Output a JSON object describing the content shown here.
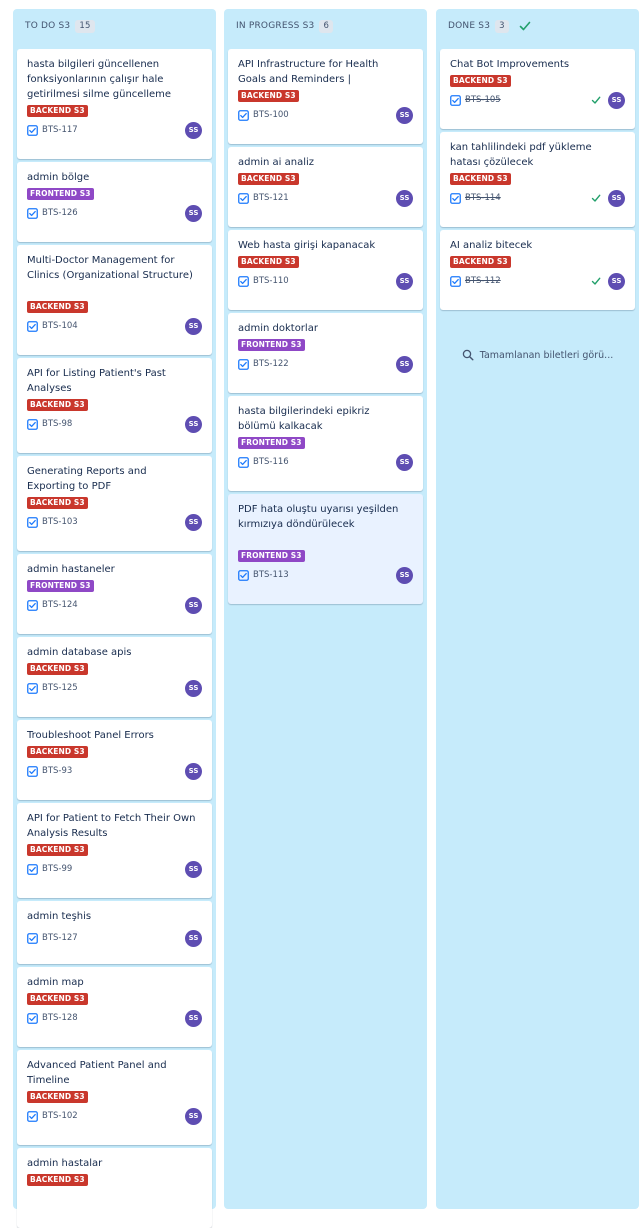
{
  "columns": [
    {
      "title": "TO DO S3",
      "count": "15",
      "cards": [
        {
          "title": "hasta bilgileri güncellenen fonksiyonlarının çalışır hale getirilmesi silme güncelleme",
          "label": "BACKEND S3",
          "label_kind": "backend",
          "key": "BTS-117",
          "assignee": "SS"
        },
        {
          "title": "admin bölge",
          "label": "FRONTEND S3",
          "label_kind": "frontend",
          "key": "BTS-126",
          "assignee": "SS"
        },
        {
          "title": "Multi-Doctor Management for Clinics (Organizational Structure)",
          "label": "BACKEND S3",
          "label_kind": "backend",
          "key": "BTS-104",
          "assignee": "SS"
        },
        {
          "title": "API for Listing Patient's Past Analyses",
          "label": "BACKEND S3",
          "label_kind": "backend",
          "key": "BTS-98",
          "assignee": "SS"
        },
        {
          "title": "Generating Reports and Exporting to PDF",
          "label": "BACKEND S3",
          "label_kind": "backend",
          "key": "BTS-103",
          "assignee": "SS"
        },
        {
          "title": "admin hastaneler",
          "label": "FRONTEND S3",
          "label_kind": "frontend",
          "key": "BTS-124",
          "assignee": "SS"
        },
        {
          "title": "admin database apis",
          "label": "BACKEND S3",
          "label_kind": "backend",
          "key": "BTS-125",
          "assignee": "SS"
        },
        {
          "title": "Troubleshoot Panel Errors",
          "label": "BACKEND S3",
          "label_kind": "backend",
          "key": "BTS-93",
          "assignee": "SS"
        },
        {
          "title": "API for Patient to Fetch Their Own Analysis Results",
          "label": "BACKEND S3",
          "label_kind": "backend",
          "key": "BTS-99",
          "assignee": "SS"
        },
        {
          "title": "admin teşhis",
          "label": "",
          "label_kind": "",
          "key": "BTS-127",
          "assignee": "SS"
        },
        {
          "title": "admin map",
          "label": "BACKEND S3",
          "label_kind": "backend",
          "key": "BTS-128",
          "assignee": "SS"
        },
        {
          "title": "Advanced Patient Panel and Timeline",
          "label": "BACKEND S3",
          "label_kind": "backend",
          "key": "BTS-102",
          "assignee": "SS"
        },
        {
          "title": "admin hastalar",
          "label": "BACKEND S3",
          "label_kind": "backend",
          "key": "",
          "assignee": ""
        }
      ]
    },
    {
      "title": "IN PROGRESS S3",
      "count": "6",
      "cards": [
        {
          "title": "API Infrastructure for Health Goals and Reminders |",
          "label": "BACKEND S3",
          "label_kind": "backend",
          "key": "BTS-100",
          "assignee": "SS"
        },
        {
          "title": "admin ai analiz",
          "label": "BACKEND S3",
          "label_kind": "backend",
          "key": "BTS-121",
          "assignee": "SS"
        },
        {
          "title": "Web hasta girişi kapanacak",
          "label": "BACKEND S3",
          "label_kind": "backend",
          "key": "BTS-110",
          "assignee": "SS"
        },
        {
          "title": "admin doktorlar",
          "label": "FRONTEND S3",
          "label_kind": "frontend",
          "key": "BTS-122",
          "assignee": "SS"
        },
        {
          "title": "hasta bilgilerindeki epikriz bölümü kalkacak",
          "label": "FRONTEND S3",
          "label_kind": "frontend",
          "key": "BTS-116",
          "assignee": "SS"
        },
        {
          "title": "PDF hata oluştu uyarısı yeşilden kırmızıya döndürülecek",
          "label": "FRONTEND S3",
          "label_kind": "frontend",
          "key": "BTS-113",
          "assignee": "SS"
        }
      ]
    },
    {
      "title": "DONE S3",
      "count": "3",
      "cards": [
        {
          "title": "Chat Bot Improvements",
          "label": "BACKEND S3",
          "label_kind": "backend",
          "key": "BTS-105",
          "assignee": "SS"
        },
        {
          "title": "kan tahlilindeki pdf yükleme hatası çözülecek",
          "label": "BACKEND S3",
          "label_kind": "backend",
          "key": "BTS-114",
          "assignee": "SS"
        },
        {
          "title": "AI analiz bitecek",
          "label": "BACKEND S3",
          "label_kind": "backend",
          "key": "BTS-112",
          "assignee": "SS"
        }
      ],
      "search_completed": "Tamamlanan biletleri görü..."
    }
  ],
  "colors": {
    "column_bg": "#c6ebfb",
    "backend_label": "#c9372c",
    "frontend_label": "#8f48c6",
    "avatar": "#5e4db2",
    "task_icon": "#1d7afc",
    "done_check": "#22a06b",
    "selected_card": "#e9f2ff"
  }
}
